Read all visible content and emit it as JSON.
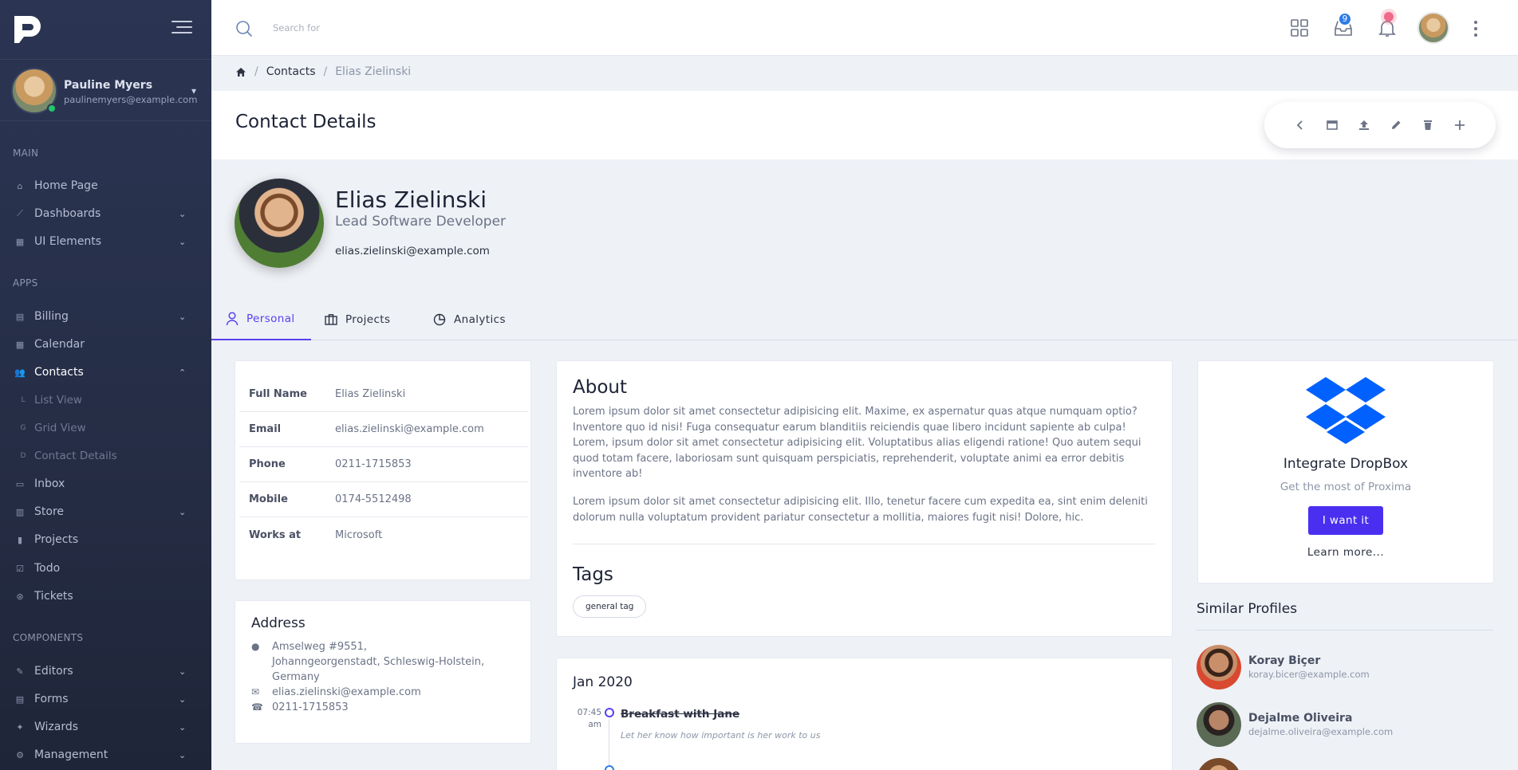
{
  "sidebar": {
    "user": {
      "name": "Pauline Myers",
      "email": "paulinemyers@example.com"
    },
    "sections": {
      "main": "MAIN",
      "apps": "APPS",
      "components": "COMPONENTS"
    },
    "main_items": [
      {
        "label": "Home Page",
        "icon": "home-icon"
      },
      {
        "label": "Dashboards",
        "icon": "chart-line-icon"
      },
      {
        "label": "UI Elements",
        "icon": "table-icon"
      }
    ],
    "app_items": [
      {
        "label": "Billing",
        "icon": "receipt-icon"
      },
      {
        "label": "Calendar",
        "icon": "calendar-icon"
      },
      {
        "label": "Contacts",
        "icon": "users-icon"
      },
      {
        "label": "List View",
        "icon": "letter-l-icon"
      },
      {
        "label": "Grid View",
        "icon": "letter-g-icon"
      },
      {
        "label": "Contact Details",
        "icon": "letter-d-icon"
      },
      {
        "label": "Inbox",
        "icon": "inbox-icon"
      },
      {
        "label": "Store",
        "icon": "store-icon"
      },
      {
        "label": "Projects",
        "icon": "briefcase-icon"
      },
      {
        "label": "Todo",
        "icon": "check-square-icon"
      },
      {
        "label": "Tickets",
        "icon": "lifebuoy-icon"
      }
    ],
    "component_items": [
      {
        "label": "Editors",
        "icon": "edit-icon"
      },
      {
        "label": "Forms",
        "icon": "form-icon"
      },
      {
        "label": "Wizards",
        "icon": "wand-icon"
      },
      {
        "label": "Management",
        "icon": "cogs-icon"
      }
    ]
  },
  "topbar": {
    "search_placeholder": "Search for",
    "inbox_badge": "9"
  },
  "breadcrumb": {
    "contacts": "Contacts",
    "current": "Elias Zielinski"
  },
  "header": {
    "title": "Contact Details"
  },
  "profile": {
    "name": "Elias Zielinski",
    "role": "Lead Software Developer",
    "email": "elias.zielinski@example.com"
  },
  "tabs": [
    {
      "label": "Personal"
    },
    {
      "label": "Projects"
    },
    {
      "label": "Analytics"
    }
  ],
  "info": [
    {
      "key": "Full Name",
      "value": "Elias Zielinski"
    },
    {
      "key": "Email",
      "value": "elias.zielinski@example.com"
    },
    {
      "key": "Phone",
      "value": "0211-1715853"
    },
    {
      "key": "Mobile",
      "value": "0174-5512498"
    },
    {
      "key": "Works at",
      "value": "Microsoft"
    }
  ],
  "address": {
    "title": "Address",
    "line1": "Amselweg #9551,",
    "line2": "Johanngeorgenstadt, Schleswig-Holstein,",
    "line3": "Germany",
    "email": "elias.zielinski@example.com",
    "phone": "0211-1715853"
  },
  "about": {
    "title": "About",
    "p1": "Lorem ipsum dolor sit amet consectetur adipisicing elit. Maxime, ex aspernatur quas atque numquam optio? Inventore quo id nisi! Fuga consequatur earum blanditiis reiciendis quae libero incidunt sapiente ab culpa! Lorem, ipsum dolor sit amet consectetur adipisicing elit. Voluptatibus alias eligendi ratione! Quo autem sequi quod totam facere, laboriosam sunt quisquam perspiciatis, reprehenderit, voluptate animi ea error debitis inventore ab!",
    "p2": "Lorem ipsum dolor sit amet consectetur adipisicing elit. Illo, tenetur facere cum expedita ea, sint enim deleniti dolorum nulla voluptatum provident pariatur consectetur a mollitia, maiores fugit nisi! Dolore, hic.",
    "tags_title": "Tags",
    "tag": "general tag"
  },
  "timeline": {
    "title": "Jan 2020",
    "time": "07:45",
    "ampm": "am",
    "event": "Breakfast with Jane",
    "note": "Let her know how important is her work to us"
  },
  "integrate": {
    "title": "Integrate DropBox",
    "subtitle": "Get the most of Proxima",
    "button": "I want it",
    "link": "Learn more...",
    "brand_color": "#0061fe"
  },
  "similar": {
    "title": "Similar Profiles",
    "people": [
      {
        "name": "Koray Biçer",
        "email": "koray.bicer@example.com"
      },
      {
        "name": "Dejalme Oliveira",
        "email": "dejalme.oliveira@example.com"
      }
    ]
  },
  "colors": {
    "accent": "#5a3ff0",
    "sidebar": "#2b3553",
    "primary_button": "#4b2ff0"
  }
}
